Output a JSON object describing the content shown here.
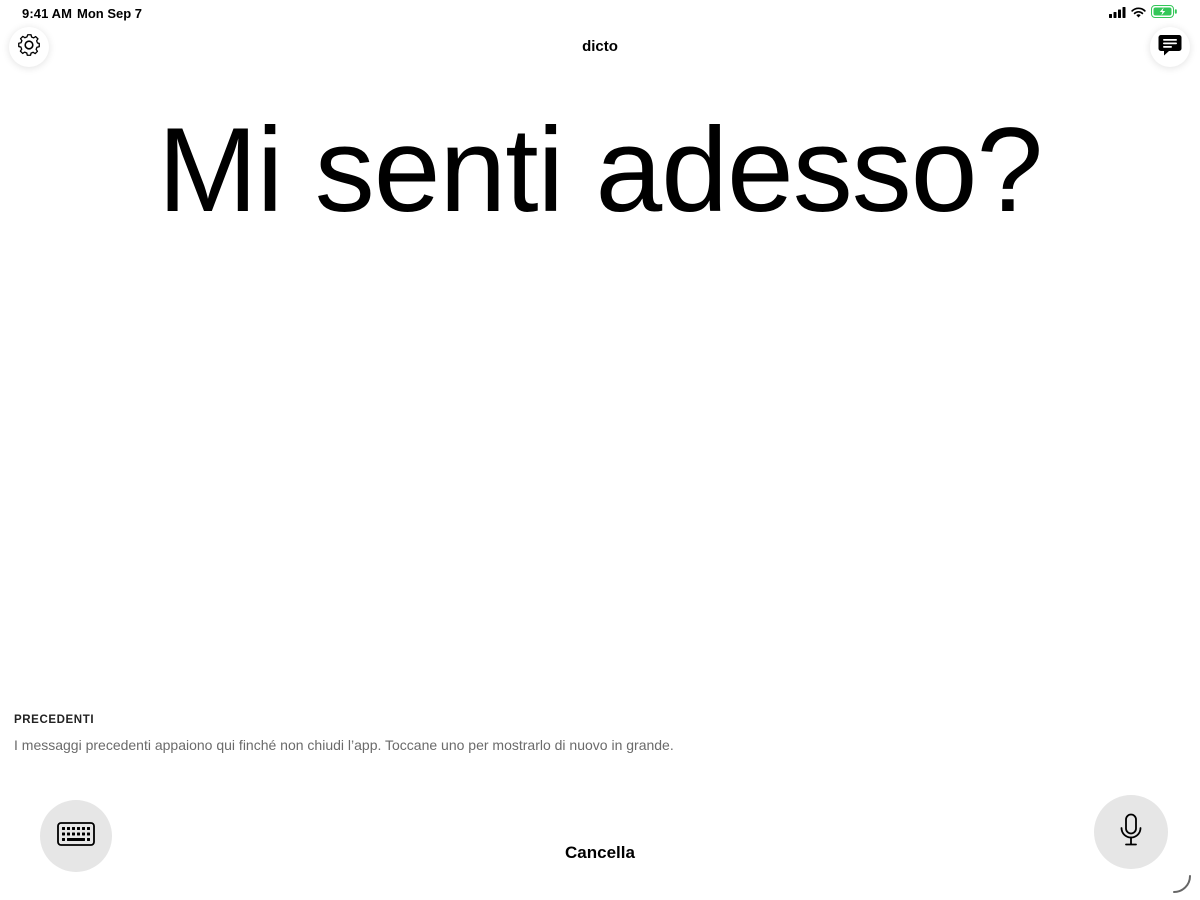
{
  "status_bar": {
    "time": "9:41 AM",
    "date": "Mon Sep 7",
    "icons": [
      "cellular-signal-icon",
      "wifi-icon",
      "battery-charging-icon"
    ],
    "battery_color": "#34c759"
  },
  "nav": {
    "title": "dicto",
    "left_button_icon": "gear-icon",
    "right_button_icon": "message-icon"
  },
  "main": {
    "message": "Mi senti adesso?"
  },
  "history": {
    "heading": "PRECEDENTI",
    "hint": "I messaggi precedenti appaiono qui finché non chiudi l’app. Toccane uno per mostrarlo di nuovo in grande."
  },
  "controls": {
    "keyboard_icon": "keyboard-icon",
    "clear_label": "Cancella",
    "mic_icon": "microphone-icon"
  },
  "colors": {
    "background": "#ffffff",
    "button_fill": "#e6e6e6",
    "hint_text": "#6b6b6b"
  }
}
